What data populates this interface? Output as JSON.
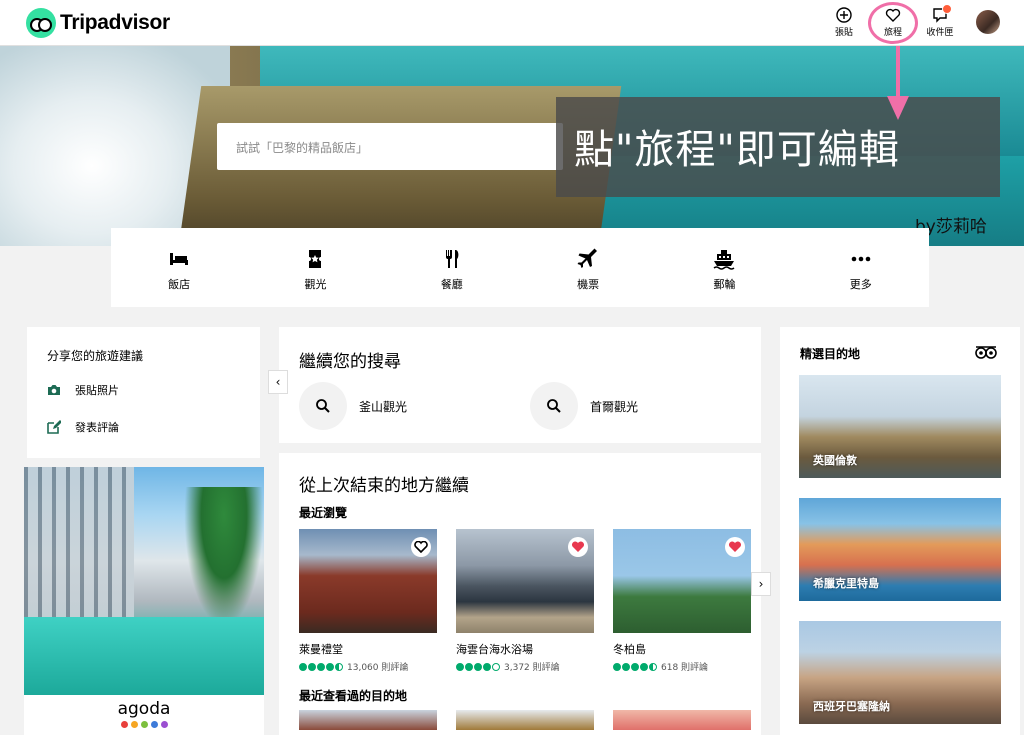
{
  "header": {
    "logo_text": "Tripadvisor",
    "post_label": "張貼",
    "trips_label": "旅程",
    "inbox_label": "收件匣"
  },
  "hero": {
    "search_placeholder": "試試「巴黎的精品飯店」",
    "overlay_text": "點\"旅程\"即可編輯",
    "byline": "by莎莉哈"
  },
  "categories": [
    {
      "label": "飯店",
      "icon": "bed-icon"
    },
    {
      "label": "觀光",
      "icon": "ticket-icon"
    },
    {
      "label": "餐廳",
      "icon": "fork-knife-icon"
    },
    {
      "label": "機票",
      "icon": "plane-icon"
    },
    {
      "label": "郵輪",
      "icon": "ship-icon"
    },
    {
      "label": "更多",
      "icon": "more-icon"
    }
  ],
  "share": {
    "title": "分享您的旅遊建議",
    "post_photo": "張貼照片",
    "write_review": "發表評論"
  },
  "ad": {
    "brand": "agoda",
    "dot_colors": [
      "#e8403b",
      "#f5a623",
      "#7cbf3d",
      "#3d7bd9",
      "#9b4fd1"
    ]
  },
  "continue_search": {
    "title": "繼續您的搜尋",
    "items": [
      {
        "label": "釜山觀光"
      },
      {
        "label": "首爾觀光"
      }
    ]
  },
  "resume": {
    "title": "從上次結束的地方繼續",
    "recently_viewed": "最近瀏覽",
    "recent_destinations": "最近查看過的目的地",
    "tiles": [
      {
        "name": "萊曼禮堂",
        "reviews": "13,060 則評論",
        "rating": 4.5,
        "saved": false
      },
      {
        "name": "海雲台海水浴場",
        "reviews": "3,372 則評論",
        "rating": 4.0,
        "saved": true
      },
      {
        "name": "冬柏島",
        "reviews": "618 則評論",
        "rating": 4.5,
        "saved": true
      }
    ]
  },
  "featured": {
    "title": "精選目的地",
    "items": [
      {
        "label": "英國倫敦"
      },
      {
        "label": "希臘克里特島"
      },
      {
        "label": "西班牙巴塞隆納"
      }
    ]
  },
  "colors": {
    "brand_green": "#34e0a1",
    "bubble_green": "#00aa6c",
    "highlight_pink": "#f06fa8",
    "heart_red": "#e8384f"
  }
}
